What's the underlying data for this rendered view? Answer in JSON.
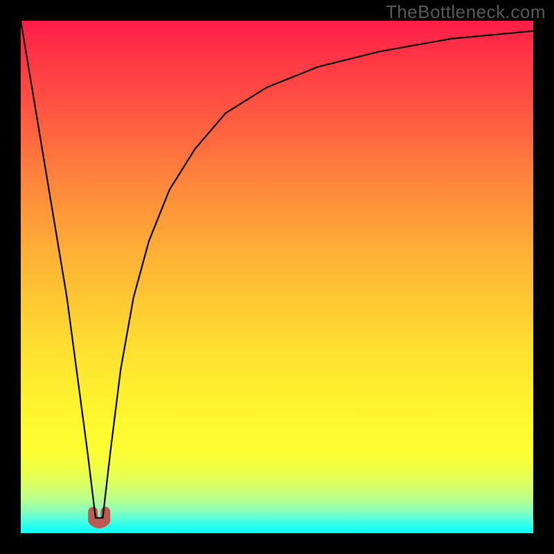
{
  "watermark": "TheBottleneck.com",
  "chart_data": {
    "type": "line",
    "title": "",
    "xlabel": "",
    "ylabel": "",
    "xlim": [
      0,
      100
    ],
    "ylim": [
      0,
      100
    ],
    "grid": false,
    "legend": false,
    "series": [
      {
        "name": "bottleneck-curve",
        "x": [
          0,
          3,
          6,
          9,
          11,
          13,
          14.6,
          16,
          17.5,
          19.5,
          22,
          25,
          29,
          34,
          40,
          48,
          58,
          70,
          84,
          100
        ],
        "y": [
          100,
          82,
          64,
          46,
          31,
          16,
          3,
          3,
          16,
          32,
          46,
          57,
          67,
          75,
          82,
          87,
          91,
          94,
          96.5,
          98
        ]
      }
    ],
    "annotations": [
      {
        "name": "dip-marker",
        "x": 15.3,
        "y": 2.5,
        "color": "#bb5a52"
      }
    ],
    "background": {
      "type": "vertical-gradient",
      "stops": [
        {
          "pos": 0.0,
          "color": "#ff1d49"
        },
        {
          "pos": 0.5,
          "color": "#ffc933"
        },
        {
          "pos": 0.85,
          "color": "#fcff33"
        },
        {
          "pos": 1.0,
          "color": "#04fffd"
        }
      ]
    }
  }
}
